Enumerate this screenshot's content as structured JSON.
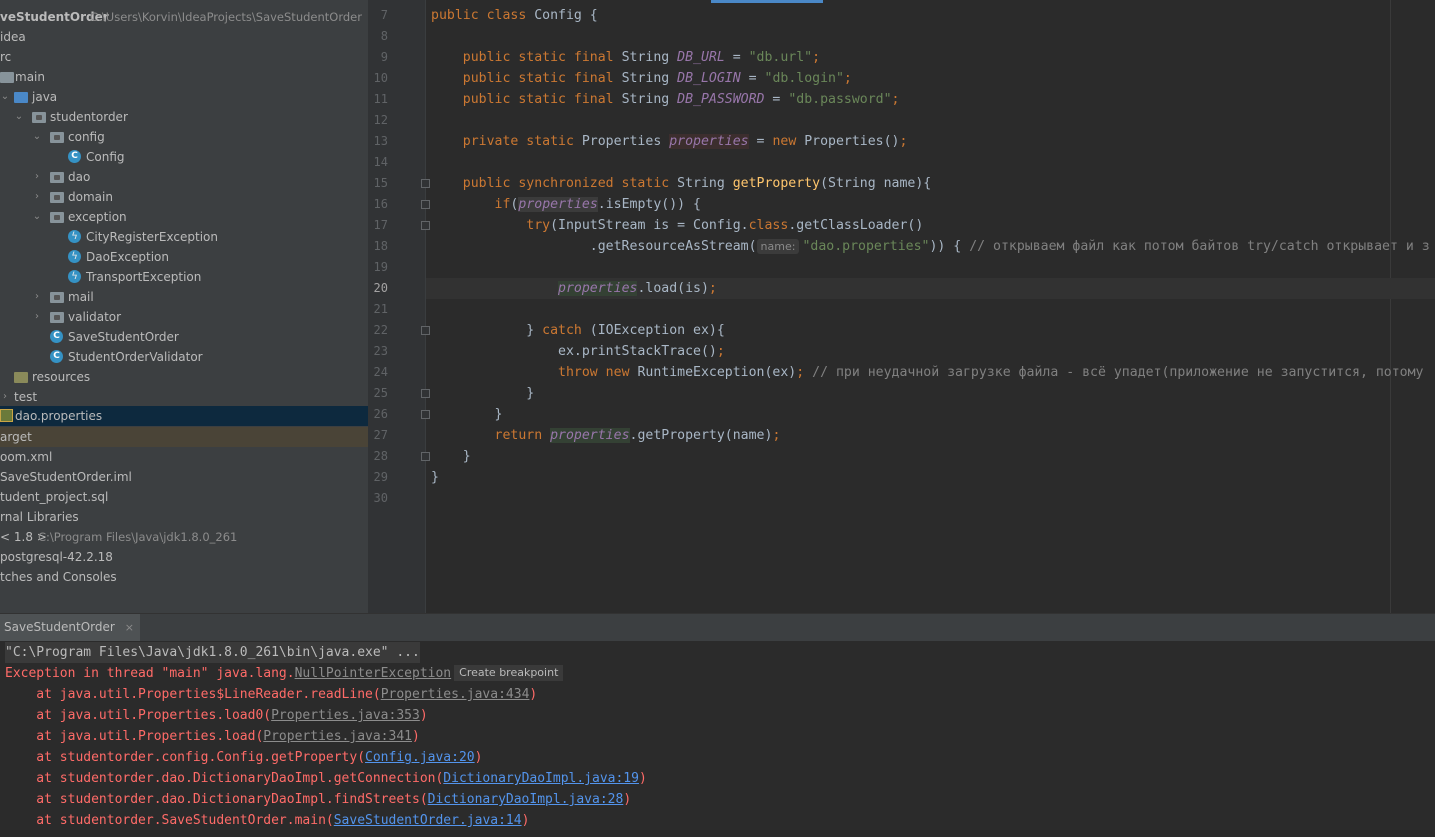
{
  "project": {
    "root_name": "veStudentOrder",
    "root_path": "C:\\Users\\Korvin\\IdeaProjects\\SaveStudentOrder",
    "items": {
      "idea": "idea",
      "src": "rc",
      "main": "main",
      "java": "java",
      "studentorder": "studentorder",
      "config": "config",
      "config_class": "Config",
      "dao": "dao",
      "domain": "domain",
      "exception": "exception",
      "city_exc": "CityRegisterException",
      "dao_exc": "DaoException",
      "transport_exc": "TransportException",
      "mail": "mail",
      "validator": "validator",
      "save_student_order": "SaveStudentOrder",
      "student_order_validator": "StudentOrderValidator",
      "resources": "resources",
      "test": "test",
      "dao_properties": "dao.properties",
      "target": "arget",
      "pom": "oom.xml",
      "iml": "SaveStudentOrder.iml",
      "sql": "tudent_project.sql",
      "ext_libs": "rnal Libraries",
      "jdk": "< 1.8 >",
      "jdk_path": "C:\\Program Files\\Java\\jdk1.8.0_261",
      "postgres": "postgresql-42.2.18",
      "scratches": "tches and Consoles"
    }
  },
  "editor": {
    "line_numbers": [
      "7",
      "8",
      "9",
      "10",
      "11",
      "12",
      "13",
      "14",
      "15",
      "16",
      "17",
      "18",
      "19",
      "20",
      "21",
      "22",
      "23",
      "24",
      "25",
      "26",
      "27",
      "28",
      "29",
      "30"
    ],
    "current_line": "20",
    "param_hint": "name:",
    "comment_18": "// открываем файл как потом байтов try/catch открывает и з",
    "comment_24": "// при неудачной загрузке файла - всё упадет(приложение не запустится, потому"
  },
  "run": {
    "tab_label": "SaveStudentOrder",
    "close_glyph": "×",
    "command": "\"C:\\Program Files\\Java\\jdk1.8.0_261\\bin\\java.exe\" ...",
    "exception_prefix": "Exception in thread \"main\" java.lang.",
    "exception_class": "NullPointerException",
    "create_breakpoint": "Create breakpoint",
    "stack": [
      {
        "text": "    at java.util.Properties$LineReader.readLine(",
        "link": "Properties.java:434",
        "tail": ")",
        "kind": "lib"
      },
      {
        "text": "    at java.util.Properties.load0(",
        "link": "Properties.java:353",
        "tail": ")",
        "kind": "lib"
      },
      {
        "text": "    at java.util.Properties.load(",
        "link": "Properties.java:341",
        "tail": ")",
        "kind": "lib"
      },
      {
        "text": "    at studentorder.config.Config.getProperty(",
        "link": "Config.java:20",
        "tail": ")",
        "kind": "user"
      },
      {
        "text": "    at studentorder.dao.DictionaryDaoImpl.getConnection(",
        "link": "DictionaryDaoImpl.java:19",
        "tail": ")",
        "kind": "user"
      },
      {
        "text": "    at studentorder.dao.DictionaryDaoImpl.findStreets(",
        "link": "DictionaryDaoImpl.java:28",
        "tail": ")",
        "kind": "user"
      },
      {
        "text": "    at studentorder.SaveStudentOrder.main(",
        "link": "SaveStudentOrder.java:14",
        "tail": ")",
        "kind": "user"
      }
    ]
  }
}
